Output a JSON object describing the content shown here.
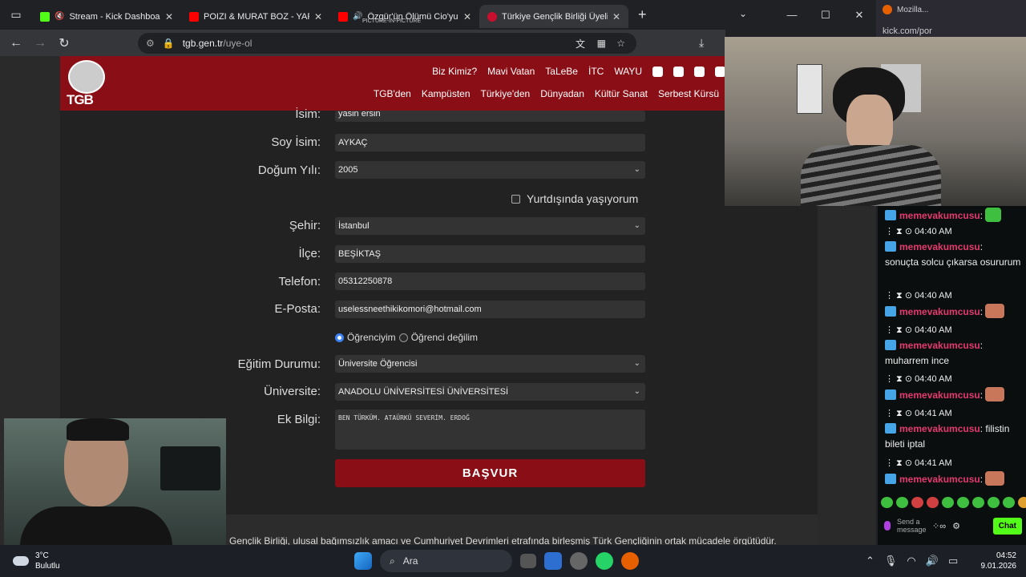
{
  "browser": {
    "tabs": [
      {
        "title": "Stream - Kick Dashboard",
        "color": "#53fc18",
        "active": false
      },
      {
        "title": "POIZI & MURAT BOZ - YAPAR M",
        "color": "#ff0000",
        "active": false
      },
      {
        "title": "Özgür'ün Ölümü Cio'yu Yıkt",
        "subtitle": "PICTURE-IN-PICTURE",
        "color": "#ff0000",
        "active": false
      },
      {
        "title": "Türkiye Gençlik Birliği Üyelik Ba",
        "color": "#c8102e",
        "active": true
      }
    ],
    "url_host": "tgb.gen.tr",
    "url_path": "/uye-ol"
  },
  "site": {
    "logo_text": "TGB",
    "nav_top": [
      "Biz Kimiz?",
      "Mavi Vatan",
      "TaLeBe",
      "İTC",
      "WAYU"
    ],
    "nav_bottom": [
      "TGB'den",
      "Kampüsten",
      "Türkiye'den",
      "Dünyadan",
      "Kültür Sanat",
      "Serbest Kürsü"
    ]
  },
  "form": {
    "labels": {
      "name": "İsim:",
      "surname": "Soy İsim:",
      "birth_year": "Doğum Yılı:",
      "city": "Şehir:",
      "district": "İlçe:",
      "phone": "Telefon:",
      "email": "E-Posta:",
      "education": "Eğitim Durumu:",
      "university": "Üniversite:",
      "extra": "Ek Bilgi:"
    },
    "values": {
      "name": "yasin ersin",
      "surname": "AYKAÇ",
      "birth_year": "2005",
      "city": "İstanbul",
      "district": "BEŞİKTAŞ",
      "phone": "05312250878",
      "email": "uselessneethikikomori@hotmail.com",
      "education": "Üniversite Öğrencisi",
      "university": "ANADOLU ÜNİVERSİTESİ ÜNİVERSİTESİ",
      "extra": "BEN TÜRKÜM. ATAÜRKÜ SEVERİM. ERDOĞ"
    },
    "abroad_label": "Yurtdışında yaşıyorum",
    "radio_student": "Öğrenciyim",
    "radio_not_student": "Öğrenci değilim",
    "submit": "BAŞVUR"
  },
  "footer_text": "Gençlik Birliği, ulusal bağımsızlık amacı ve Cumhuriyet Devrimleri etrafında birleşmiş Türk Gençliğinin ortak mücadele örgütüdür.",
  "firefox": {
    "title": "Mozilla...",
    "url": "kick.com/por"
  },
  "chat": {
    "messages": [
      {
        "time": "",
        "user": "memevakumcusu",
        "text": "",
        "emote": true
      },
      {
        "time": "04:40 AM",
        "user": "memevakumcusu",
        "text": "sonuçta solcu çıkarsa osururum",
        "emote": false
      },
      {
        "time": "04:40 AM",
        "user": "memevakumcusu",
        "text": "",
        "emote": true
      },
      {
        "time": "04:40 AM",
        "user": "memevakumcusu",
        "text": "muharrem ince",
        "emote": false
      },
      {
        "time": "04:40 AM",
        "user": "memevakumcusu",
        "text": "",
        "emote": true
      },
      {
        "time": "04:41 AM",
        "user": "memevakumcusu",
        "text": "filistin bileti iptal",
        "emote": false
      },
      {
        "time": "04:41 AM",
        "user": "memevakumcusu",
        "text": "",
        "emote": true
      }
    ],
    "input_placeholder": "Send a message",
    "send_label": "Chat"
  },
  "taskbar": {
    "temp": "3°C",
    "weather": "Bulutlu",
    "search": "Ara",
    "time": "04:52",
    "date": "9.01.2026"
  }
}
